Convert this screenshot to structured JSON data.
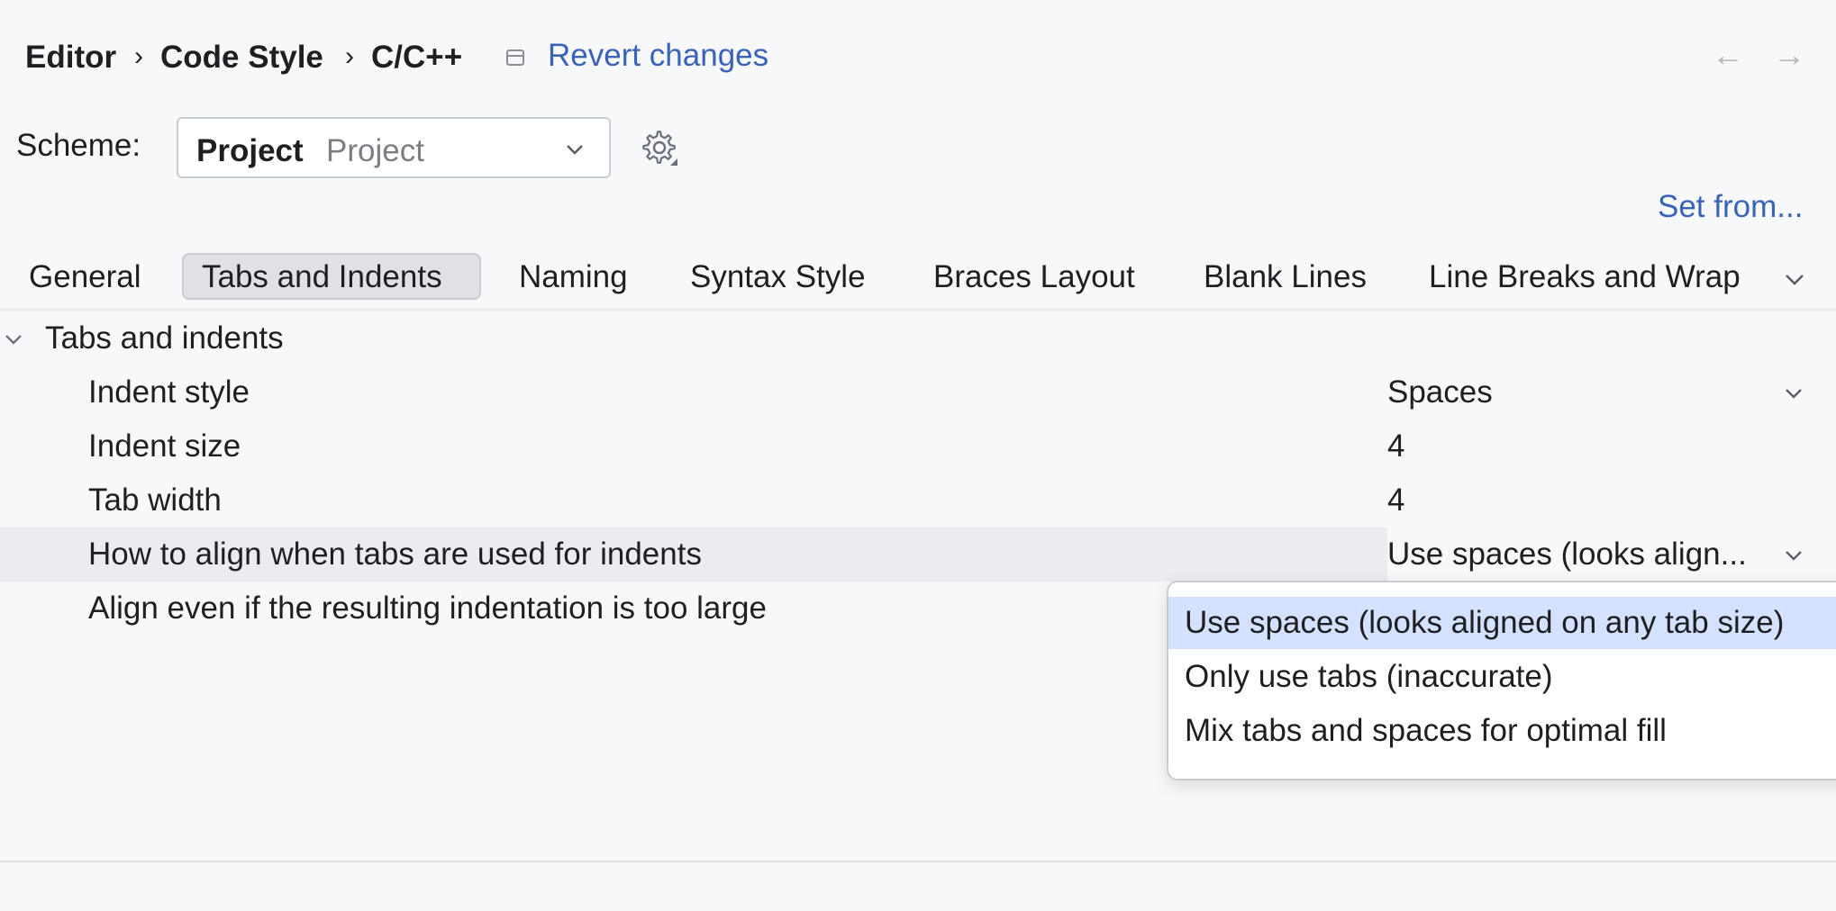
{
  "breadcrumb": {
    "items": [
      "Editor",
      "Code Style",
      "C/C++"
    ],
    "separator": "›",
    "revert_label": "Revert changes"
  },
  "nav": {
    "back": "←",
    "forward": "→"
  },
  "scheme": {
    "label": "Scheme:",
    "name": "Project",
    "subtitle": "Project"
  },
  "set_from_label": "Set from...",
  "tabs": [
    {
      "label": "General"
    },
    {
      "label": "Tabs and Indents",
      "selected": true
    },
    {
      "label": "Naming"
    },
    {
      "label": "Syntax Style"
    },
    {
      "label": "Braces Layout"
    },
    {
      "label": "Blank Lines"
    },
    {
      "label": "Line Breaks and Wrap"
    }
  ],
  "section": {
    "title": "Tabs and indents",
    "rows": [
      {
        "label": "Indent style",
        "value": "Spaces"
      },
      {
        "label": "Indent size",
        "value": "4"
      },
      {
        "label": "Tab width",
        "value": "4"
      },
      {
        "label": "How to align when tabs are used for indents",
        "value": "Use spaces (looks align..."
      },
      {
        "label": "Align even if the resulting indentation is too large",
        "value": ""
      }
    ]
  },
  "dropdown": {
    "options": [
      {
        "label": "Use spaces (looks aligned on any tab size)",
        "selected": true
      },
      {
        "label": "Only use tabs (inaccurate)"
      },
      {
        "label": "Mix tabs and spaces for optimal fill"
      }
    ]
  },
  "colors": {
    "accent_link": "#3a63b7",
    "row_highlight": "#ebecf0",
    "popup_selected": "#d4e2ff",
    "background": "#f7f8fa"
  },
  "icons": [
    "settings-note-icon",
    "back-arrow-icon",
    "forward-arrow-icon",
    "chevron-down-icon",
    "gear-icon",
    "collapse-chevron-icon"
  ]
}
